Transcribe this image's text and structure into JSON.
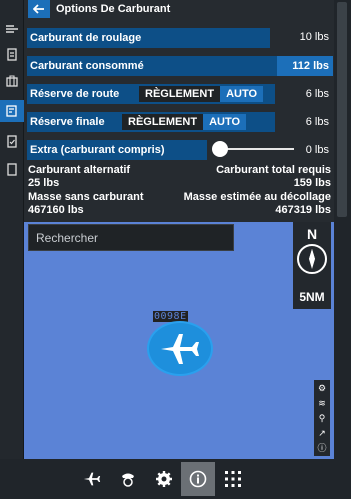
{
  "header": {
    "title": "Options De Carburant"
  },
  "rows": {
    "taxi": {
      "label": "Carburant de roulage",
      "value": "10 lbs"
    },
    "consumed": {
      "label": "Carburant consommé",
      "value": "112 lbs"
    },
    "route_reserve": {
      "label": "Réserve de route",
      "rule": "RÈGLEMENT",
      "mode": "AUTO",
      "value": "6 lbs"
    },
    "final_reserve": {
      "label": "Réserve finale",
      "rule": "RÈGLEMENT",
      "mode": "AUTO",
      "value": "6 lbs"
    },
    "extra": {
      "label": "Extra (carburant compris)",
      "value": "0 lbs",
      "slider_fraction": 0.0
    }
  },
  "summary": {
    "alt_label": "Carburant alternatif",
    "alt_value": "25 lbs",
    "total_label": "Carburant total requis",
    "total_value": "159 lbs",
    "zfw_label": "Masse sans carburant",
    "zfw_value": "467160 lbs",
    "tow_label": "Masse estimée au décollage",
    "tow_value": "467319 lbs"
  },
  "map": {
    "search_placeholder": "Rechercher",
    "north_label": "N",
    "range_label": "5NM",
    "aircraft_tag": "0098E"
  },
  "colors": {
    "accent": "#1c6fb9",
    "bar": "#0d4f87",
    "map": "#5b83d6",
    "panel": "#262b30"
  }
}
